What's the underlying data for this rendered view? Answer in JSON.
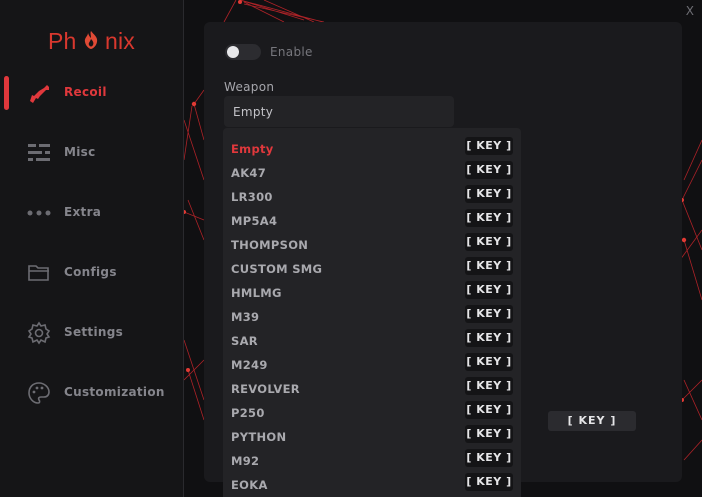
{
  "brand": {
    "logo_text_pre": "Ph",
    "logo_text_post": "nix",
    "accent": "#e0383c"
  },
  "window": {
    "close_label": "X"
  },
  "sidebar": {
    "items": [
      {
        "label": "Recoil",
        "icon": "rifle-icon",
        "active": true
      },
      {
        "label": "Misc",
        "icon": "sliders-icon",
        "active": false
      },
      {
        "label": "Extra",
        "icon": "more-dots-icon",
        "active": false
      },
      {
        "label": "Configs",
        "icon": "folder-icon",
        "active": false
      },
      {
        "label": "Settings",
        "icon": "gear-icon",
        "active": false
      },
      {
        "label": "Customization",
        "icon": "palette-icon",
        "active": false
      }
    ]
  },
  "main": {
    "enable_label": "Enable",
    "enable_on": false,
    "weapon_label": "Weapon",
    "weapon_value": "Empty",
    "dropdown": {
      "key_label": "[ KEY ]",
      "items": [
        "Empty",
        "AK47",
        "LR300",
        "MP5A4",
        "THOMPSON",
        "CUSTOM SMG",
        "HMLMG",
        "M39",
        "SAR",
        "M249",
        "REVOLVER",
        "P250",
        "PYTHON",
        "M92",
        "EOKA"
      ],
      "selected": "Empty"
    },
    "key_button_label": "[ KEY ]"
  }
}
